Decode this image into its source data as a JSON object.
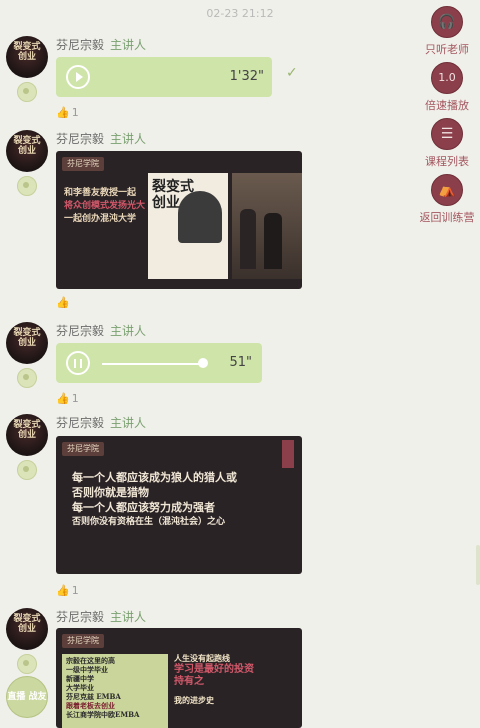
{
  "timestamp": "02-23 21:12",
  "speaker": {
    "name": "芬尼宗毅",
    "role": "主讲人",
    "avatar_text": "裂变式 创业"
  },
  "messages": [
    {
      "type": "audio",
      "duration": "1'32\"",
      "state": "play"
    },
    {
      "type": "image",
      "brand": "芬尼学院",
      "lines": [
        "和李善友教授一起",
        "将众创模式发扬光大",
        "一起创办混沌大学"
      ],
      "headline": "裂变式创业"
    },
    {
      "type": "audio",
      "duration": "51\"",
      "state": "pause",
      "progress": 0.9
    },
    {
      "type": "image",
      "brand": "芬尼学院",
      "lines": [
        "每一个人都应该成为狼人的猎人或",
        "否则你就是猎物",
        "每一个人都应该努力成为强者",
        "否则你没有资格在生（混沌社会）之心"
      ]
    },
    {
      "type": "image",
      "brand": "芬尼学院",
      "left_lines": [
        "宗毅在这里的高",
        "一级中学毕业",
        "新疆中学",
        "大学毕业",
        "芬尼克兹 EMBA",
        "跟着老板去创业",
        "长江商学院中欧EMBA"
      ],
      "right_lines": [
        "人生没有起跑线",
        "学习是最好的投资",
        "持有之",
        "我的进步史"
      ]
    }
  ],
  "right_bar": [
    {
      "label": "只听老师",
      "icon": "headphones-icon",
      "glyph": "🎧"
    },
    {
      "label": "倍速播放",
      "icon": "speed-icon",
      "glyph": "1.0"
    },
    {
      "label": "课程列表",
      "icon": "list-icon",
      "glyph": "☰"
    },
    {
      "label": "返回训练营",
      "icon": "tent-icon",
      "glyph": "⛺"
    }
  ],
  "bottom_badge": "直播 战友",
  "colors": {
    "bubble": "#cfe4a9",
    "role": "#7aa070",
    "accent": "#8b3f4a"
  }
}
